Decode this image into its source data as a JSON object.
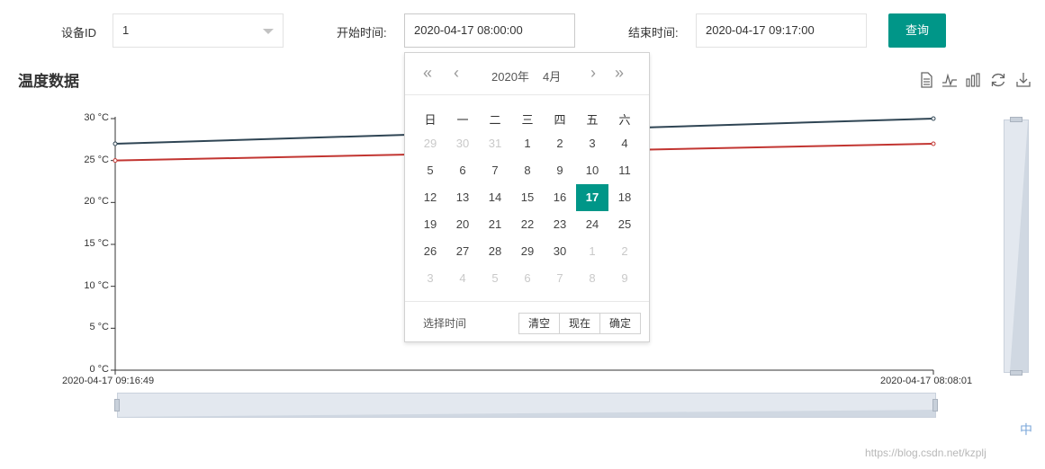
{
  "form": {
    "device_label": "设备ID",
    "device_value": "1",
    "start_label": "开始时间:",
    "start_value": "2020-04-17 08:00:00",
    "end_label": "结束时间:",
    "end_value": "2020-04-17 09:17:00",
    "query_button": "查询"
  },
  "section_title": "温度数据",
  "toolbox": [
    "data-view-icon",
    "line-chart-icon",
    "bar-chart-icon",
    "restore-icon",
    "save-image-icon"
  ],
  "colors": {
    "primary": "#009688",
    "series_dark": "#2f4554",
    "series_red": "#c23531"
  },
  "chart_data": {
    "type": "line",
    "x": [
      "2020-04-17 09:16:49",
      "2020-04-17 08:08:01"
    ],
    "y_ticks": [
      "0 °C",
      "5 °C",
      "10 °C",
      "15 °C",
      "20 °C",
      "25 °C",
      "30 °C"
    ],
    "ylim": [
      0,
      30
    ],
    "series": [
      {
        "values": [
          27,
          30
        ],
        "color": "#2f4554"
      },
      {
        "values": [
          25,
          27
        ],
        "color": "#c23531"
      }
    ],
    "grid": false,
    "dataZoom": {
      "horizontal": true,
      "vertical": true
    }
  },
  "picker": {
    "year_label": "2020年",
    "month_label": "4月",
    "weekdays": [
      "日",
      "一",
      "二",
      "三",
      "四",
      "五",
      "六"
    ],
    "days": [
      [
        "29",
        "30",
        "31",
        "1",
        "2",
        "3",
        "4"
      ],
      [
        "5",
        "6",
        "7",
        "8",
        "9",
        "10",
        "11"
      ],
      [
        "12",
        "13",
        "14",
        "15",
        "16",
        "17",
        "18"
      ],
      [
        "19",
        "20",
        "21",
        "22",
        "23",
        "24",
        "25"
      ],
      [
        "26",
        "27",
        "28",
        "29",
        "30",
        "1",
        "2"
      ],
      [
        "3",
        "4",
        "5",
        "6",
        "7",
        "8",
        "9"
      ]
    ],
    "selected_day": "17",
    "footer_label": "选择时间",
    "clear_button": "清空",
    "now_button": "现在",
    "confirm_button": "确定"
  },
  "watermark_text": "https://blog.csdn.net/kzplj",
  "ime_badge": "中"
}
